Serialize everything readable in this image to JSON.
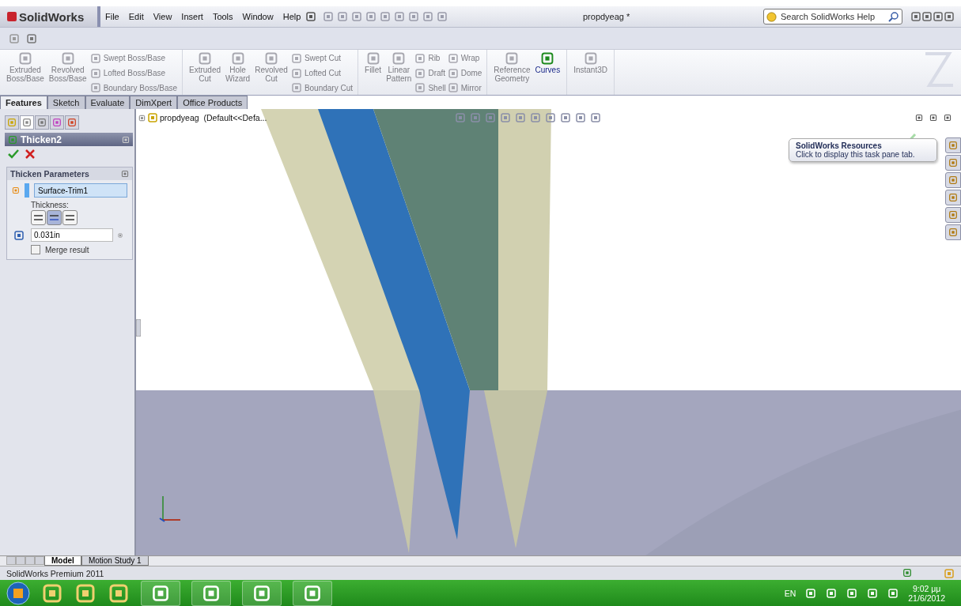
{
  "title_bar": {
    "logo": "SolidWorks",
    "menu": [
      "File",
      "Edit",
      "View",
      "Insert",
      "Tools",
      "Window",
      "Help"
    ],
    "document_title": "propdyeag *",
    "search": {
      "placeholder": "Search SolidWorks Help"
    }
  },
  "ribbon": {
    "groups": [
      {
        "columns": [
          {
            "kind": "large",
            "lines": [
              "Extruded",
              "Boss/Base"
            ],
            "disabled": true
          },
          {
            "kind": "large",
            "lines": [
              "Revolved",
              "Boss/Base"
            ],
            "disabled": true
          },
          {
            "kind": "stack",
            "items": [
              {
                "label": "Swept Boss/Base",
                "disabled": true
              },
              {
                "label": "Lofted Boss/Base",
                "disabled": true
              },
              {
                "label": "Boundary Boss/Base",
                "disabled": true
              }
            ]
          }
        ]
      },
      {
        "columns": [
          {
            "kind": "large",
            "lines": [
              "Extruded",
              "Cut"
            ],
            "disabled": true
          },
          {
            "kind": "large",
            "lines": [
              "Hole",
              "Wizard"
            ],
            "disabled": true
          },
          {
            "kind": "large",
            "lines": [
              "Revolved",
              "Cut"
            ],
            "disabled": true
          },
          {
            "kind": "stack",
            "items": [
              {
                "label": "Swept Cut",
                "disabled": true
              },
              {
                "label": "Lofted Cut",
                "disabled": true
              },
              {
                "label": "Boundary Cut",
                "disabled": true
              }
            ]
          }
        ]
      },
      {
        "columns": [
          {
            "kind": "large",
            "lines": [
              "Fillet"
            ],
            "disabled": true
          },
          {
            "kind": "large",
            "lines": [
              "Linear",
              "Pattern"
            ],
            "disabled": true
          },
          {
            "kind": "stack",
            "items": [
              {
                "label": "Rib",
                "disabled": true
              },
              {
                "label": "Draft",
                "disabled": true
              },
              {
                "label": "Shell",
                "disabled": true
              }
            ]
          },
          {
            "kind": "stack",
            "items": [
              {
                "label": "Wrap",
                "disabled": true
              },
              {
                "label": "Dome",
                "disabled": true
              },
              {
                "label": "Mirror",
                "disabled": true
              }
            ]
          }
        ]
      },
      {
        "columns": [
          {
            "kind": "large",
            "lines": [
              "Reference",
              "Geometry"
            ],
            "disabled": true
          },
          {
            "kind": "large",
            "lines": [
              "Curves"
            ],
            "disabled": false
          }
        ]
      },
      {
        "columns": [
          {
            "kind": "large",
            "lines": [
              "Instant3D"
            ],
            "disabled": true
          }
        ]
      }
    ]
  },
  "command_tabs": [
    {
      "label": "Features",
      "selected": true
    },
    {
      "label": "Sketch",
      "selected": false
    },
    {
      "label": "Evaluate",
      "selected": false
    },
    {
      "label": "DimXpert",
      "selected": false
    },
    {
      "label": "Office Products",
      "selected": false
    }
  ],
  "property_manager": {
    "title": "Thicken2",
    "section": {
      "title": "Thicken Parameters",
      "face": "Surface-Trim1",
      "thickness_label": "Thickness:",
      "sides": [
        {
          "selected": false
        },
        {
          "selected": true
        },
        {
          "selected": false
        }
      ],
      "thickness": "0.031in",
      "merge_result": {
        "label": "Merge result",
        "checked": false
      }
    }
  },
  "viewport": {
    "tree_item": "propdyeag  (Default<<Defa...",
    "tooltip": {
      "title": "SolidWorks Resources",
      "text": "Click to display this task pane tab."
    }
  },
  "bottom_tabs": [
    {
      "label": "Model",
      "selected": true
    },
    {
      "label": "Motion Study 1",
      "selected": false
    }
  ],
  "status_bar": "SolidWorks Premium 2011",
  "taskbar": {
    "language": "EN",
    "time": "9:02 μμ",
    "date": "21/6/2012"
  }
}
